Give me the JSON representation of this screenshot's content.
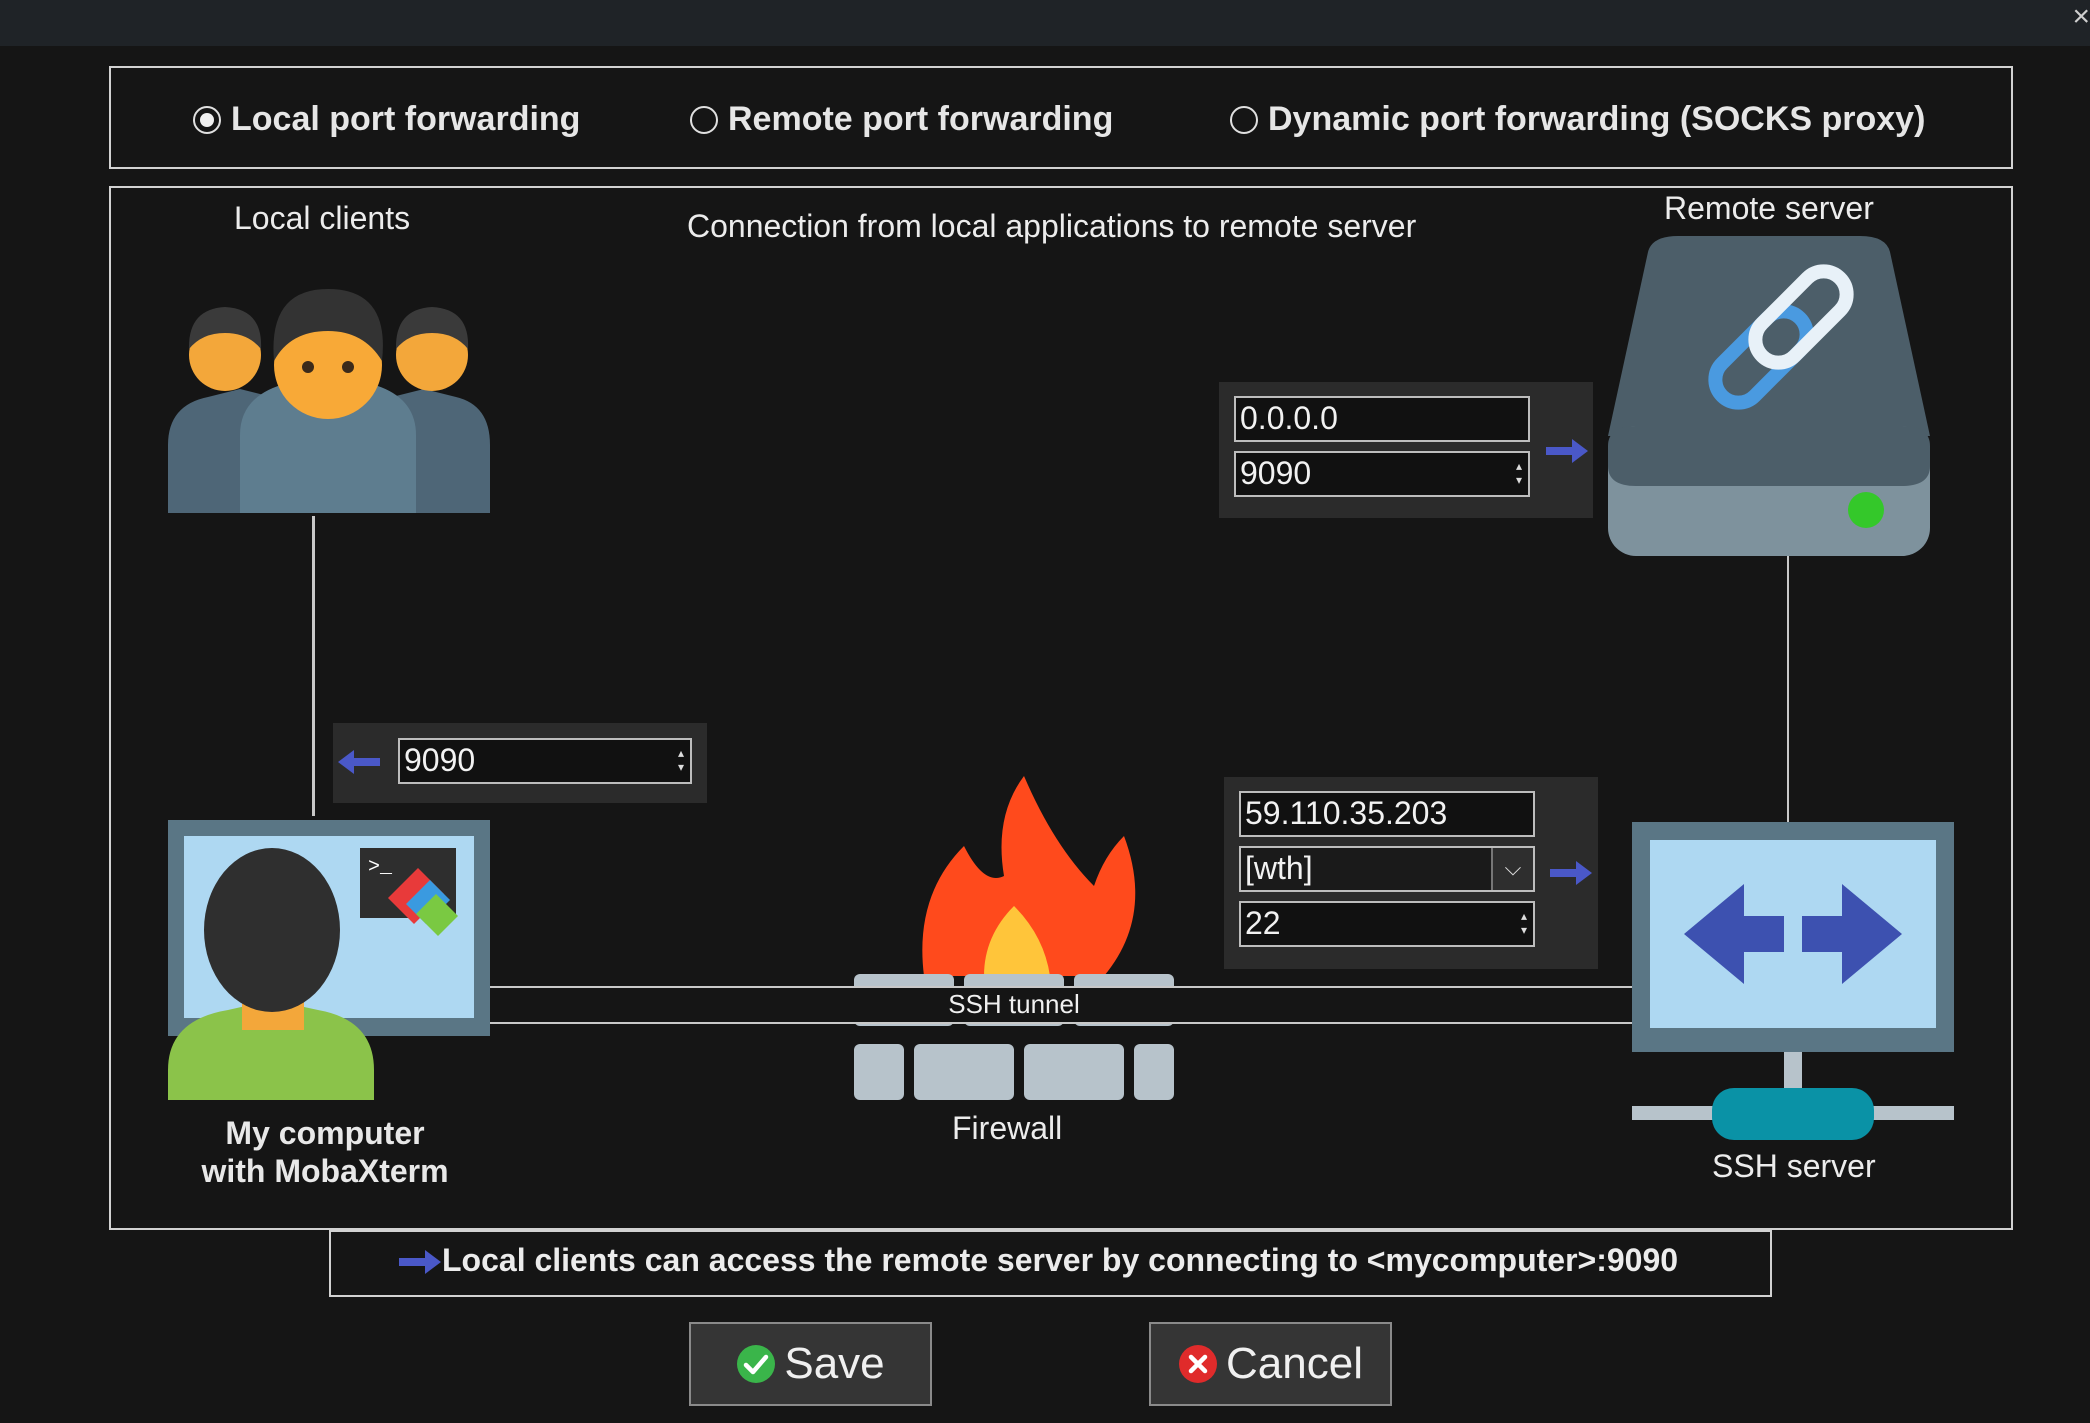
{
  "forwarding_modes": {
    "local": "Local port forwarding",
    "remote": "Remote port forwarding",
    "dynamic": "Dynamic port forwarding (SOCKS proxy)",
    "selected": "local"
  },
  "diagram": {
    "local_clients_label": "Local clients",
    "description": "Connection from local applications to remote server",
    "remote_server_label": "Remote server",
    "remote_server_host": "0.0.0.0",
    "remote_server_port": "9090",
    "local_port": "9090",
    "ssh_server_host": "59.110.35.203",
    "ssh_user": "[wth]",
    "ssh_port": "22",
    "ssh_tunnel_label": "SSH tunnel",
    "firewall_label": "Firewall",
    "my_computer_line1": "My computer",
    "my_computer_line2": "with MobaXterm",
    "ssh_server_label": "SSH server"
  },
  "summary": "Local clients can access the remote server by connecting to <mycomputer>:9090",
  "buttons": {
    "save": "Save",
    "cancel": "Cancel"
  },
  "colors": {
    "arrow": "#4a58c8",
    "save_icon": "#3ab54a",
    "cancel_icon": "#e02b2b",
    "status_led": "#34c82a"
  }
}
